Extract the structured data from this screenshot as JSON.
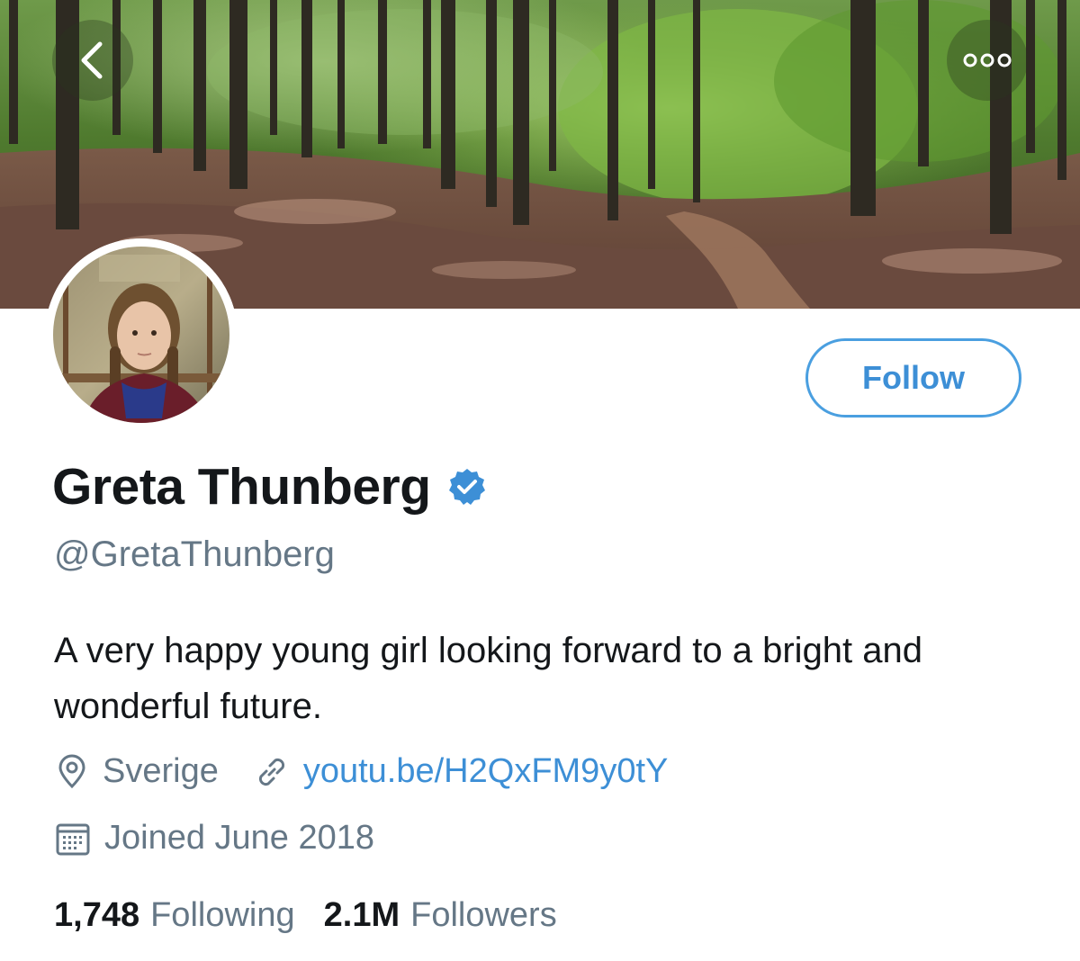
{
  "banner": {
    "description_icon": "forest-banner"
  },
  "nav": {
    "back_icon": "chevron-left-icon",
    "more_icon": "more-dots-icon"
  },
  "profile": {
    "display_name": "Greta Thunberg",
    "verified_icon": "verified-badge-icon",
    "handle": "@GretaThunberg",
    "bio": "A very happy young girl looking forward to a bright and wonderful future.",
    "location": "Sverige",
    "website": "youtu.be/H2QxFM9y0tY",
    "joined": "Joined June 2018"
  },
  "actions": {
    "follow_label": "Follow"
  },
  "stats": {
    "following_count": "1,748",
    "following_label": "Following",
    "followers_count": "2.1M",
    "followers_label": "Followers"
  },
  "colors": {
    "accent": "#4a9fe0",
    "text_primary": "#14171a",
    "text_secondary": "#657786"
  }
}
